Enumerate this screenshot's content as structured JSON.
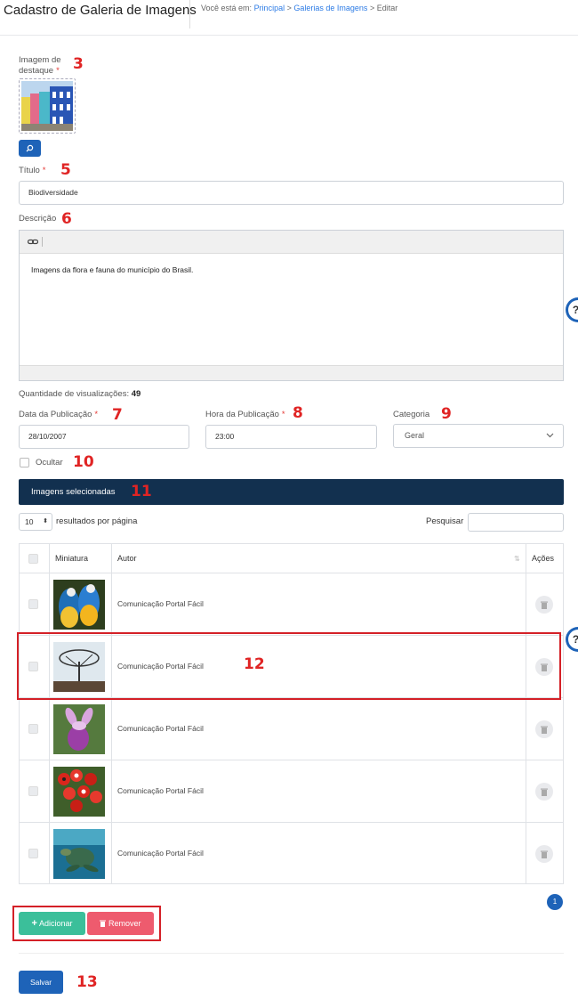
{
  "header": {
    "title": "Cadastro de Galeria de Imagens",
    "breadcrumb_prefix": "Você está em:",
    "breadcrumb": [
      "Principal",
      "Galerias de Imagens",
      "Editar"
    ],
    "separator": ">"
  },
  "form": {
    "featured_image_label_1": "Imagem de",
    "featured_image_label_2": "destaque",
    "required_mark": "*",
    "title_label": "Título",
    "title_value": "Biodiversidade",
    "description_label": "Descrição",
    "description_text": "Imagens da flora e fauna do município do Brasil.",
    "views_label": "Quantidade de visualizações:",
    "views_value": "49",
    "date_label": "Data da Publicação",
    "date_value": "28/10/2007",
    "time_label": "Hora da Publicação",
    "time_value": "23:00",
    "category_label": "Categoria",
    "category_value": "Geral",
    "hide_label": "Ocultar"
  },
  "images_section": {
    "header": "Imagens selecionadas",
    "page_size": "10",
    "page_size_suffix": "resultados por página",
    "search_label": "Pesquisar",
    "columns": [
      "Miniatura",
      "Autor",
      "Ações"
    ],
    "rows": [
      {
        "author": "Comunicação Portal Fácil",
        "thumb": "macaws"
      },
      {
        "author": "Comunicação Portal Fácil",
        "thumb": "tree"
      },
      {
        "author": "Comunicação Portal Fácil",
        "thumb": "orchid"
      },
      {
        "author": "Comunicação Portal Fácil",
        "thumb": "guarana"
      },
      {
        "author": "Comunicação Portal Fácil",
        "thumb": "turtle"
      }
    ],
    "current_page": "1",
    "add_label": "Adicionar",
    "remove_label": "Remover"
  },
  "save_label": "Salvar",
  "annotations": [
    "3",
    "5",
    "6",
    "7",
    "8",
    "9",
    "10",
    "11",
    "12",
    "13"
  ],
  "colors": {
    "primary": "#1e63b8",
    "dark_bar": "#12304f",
    "add": "#3bbf9a",
    "remove": "#ee5b6e",
    "annotation": "#e02424"
  }
}
